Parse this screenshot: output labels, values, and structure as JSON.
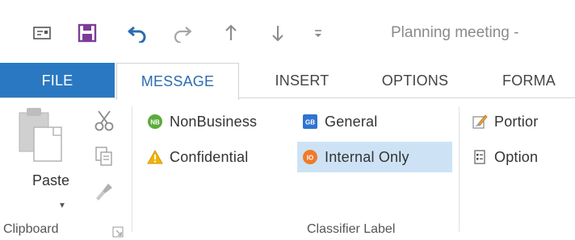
{
  "window": {
    "title": "Planning meeting -"
  },
  "quick_access": [
    {
      "name": "mail-icon"
    },
    {
      "name": "save-icon"
    },
    {
      "name": "undo-icon"
    },
    {
      "name": "redo-icon"
    },
    {
      "name": "up-arrow-icon"
    },
    {
      "name": "down-arrow-icon"
    },
    {
      "name": "customize-icon"
    }
  ],
  "tabs": [
    {
      "label": "FILE"
    },
    {
      "label": "MESSAGE"
    },
    {
      "label": "INSERT"
    },
    {
      "label": "OPTIONS"
    },
    {
      "label": "FORMA"
    }
  ],
  "clipboard": {
    "paste_label": "Paste",
    "group_label": "Clipboard"
  },
  "classifier": {
    "group_label": "Classifier Label",
    "labels": [
      {
        "label": "NonBusiness",
        "badge": "NB",
        "color": "#5aab3c"
      },
      {
        "label": "General",
        "badge": "GB",
        "color": "#2f74d0"
      },
      {
        "label": "Confidential",
        "badge": "",
        "color": "#f2b400"
      },
      {
        "label": "Internal Only",
        "badge": "IO",
        "color": "#f07a2a"
      }
    ]
  },
  "next_group": {
    "items": [
      {
        "label": "Portior"
      },
      {
        "label": "Option"
      }
    ]
  },
  "colors": {
    "file_tab": "#2b78c2",
    "active_tab_text": "#2b6cb0",
    "highlight": "#cde3f5",
    "save_icon": "#7d3c98"
  }
}
